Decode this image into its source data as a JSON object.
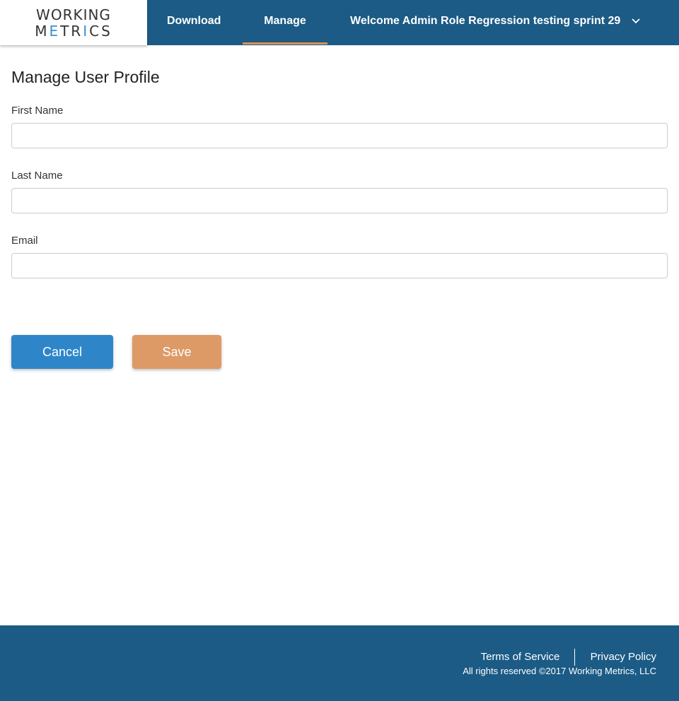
{
  "header": {
    "logo_line1": "WORKING",
    "logo_line2_a": "M",
    "logo_line2_b": "E",
    "logo_line2_c": "TR",
    "logo_line2_d": "I",
    "logo_line2_e": "CS",
    "nav": {
      "download": "Download",
      "manage": "Manage",
      "welcome": "Welcome Admin Role Regression testing sprint 29"
    },
    "active_tab": "Manage"
  },
  "main": {
    "title": "Manage User Profile",
    "fields": {
      "first_name": {
        "label": "First Name",
        "value": ""
      },
      "last_name": {
        "label": "Last Name",
        "value": ""
      },
      "email": {
        "label": "Email",
        "value": ""
      }
    },
    "buttons": {
      "cancel": "Cancel",
      "save": "Save"
    }
  },
  "footer": {
    "terms": "Terms of Service",
    "privacy": "Privacy Policy",
    "copyright": "All rights reserved ©2017 Working Metrics, LLC"
  },
  "colors": {
    "brand_blue": "#1b5b85",
    "accent_orange": "#e0914f",
    "cancel_blue": "#2e86c9",
    "save_orange": "#dd9a67"
  },
  "icons": {
    "welcome_menu": "chevron-down-icon"
  }
}
